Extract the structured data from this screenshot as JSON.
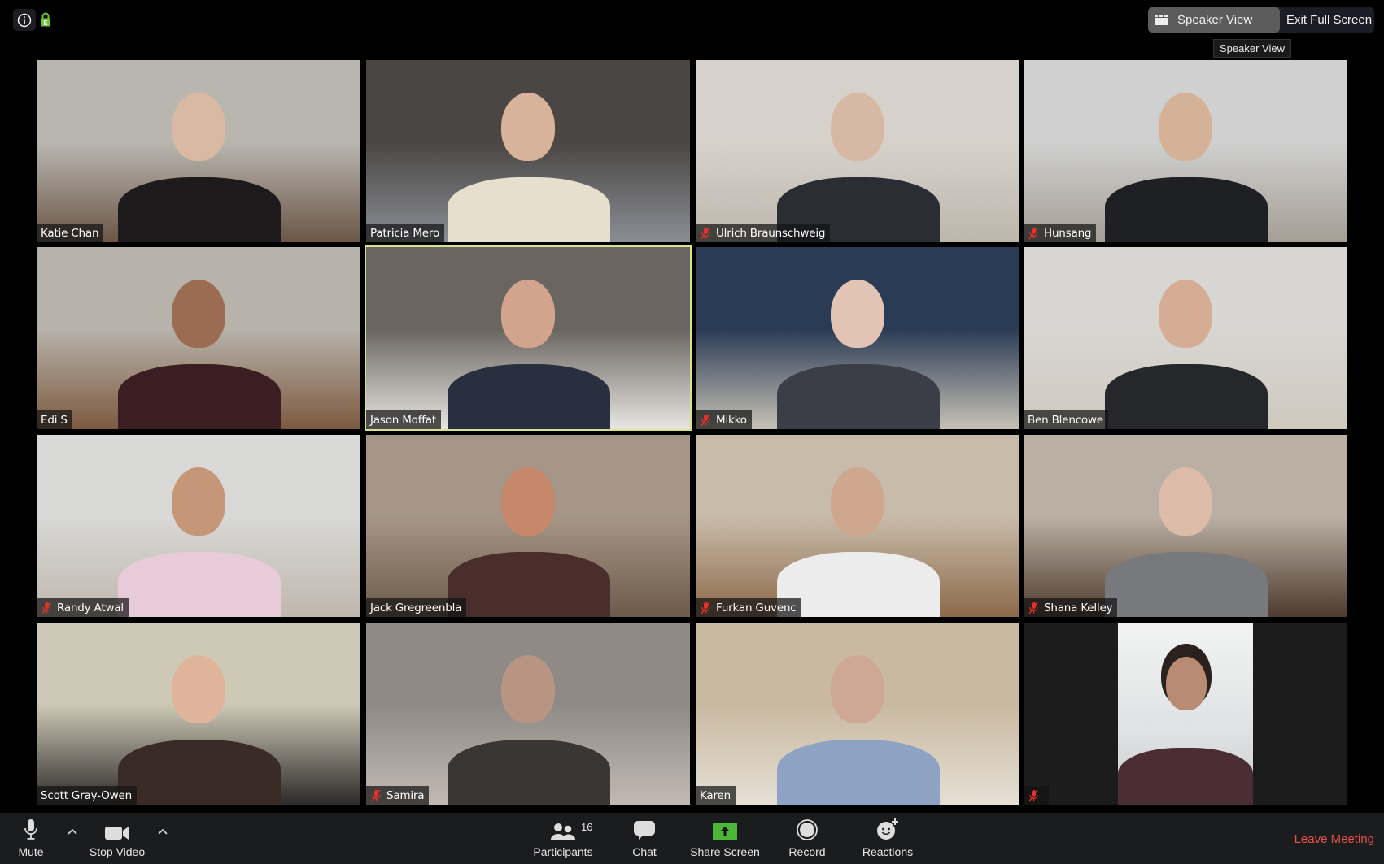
{
  "topbar": {
    "info_icon": "info-icon",
    "encryption_icon": "lock-icon",
    "encryption_badge_letter": "E",
    "speaker_view_label": "Speaker View",
    "exit_full_screen_label": "Exit Full Screen",
    "tooltip": "Speaker View"
  },
  "participants": [
    {
      "name": "Katie Chan",
      "muted": false,
      "active": false
    },
    {
      "name": "Patricia Mero",
      "muted": false,
      "active": false
    },
    {
      "name": "Ulrich Braunschweig",
      "muted": true,
      "active": false
    },
    {
      "name": "Hunsang",
      "muted": true,
      "active": false
    },
    {
      "name": "Edi S",
      "muted": false,
      "active": false
    },
    {
      "name": "Jason Moffat",
      "muted": false,
      "active": true
    },
    {
      "name": "Mikko",
      "muted": true,
      "active": false
    },
    {
      "name": "Ben Blencowe",
      "muted": false,
      "active": false
    },
    {
      "name": "Randy Atwal",
      "muted": true,
      "active": false
    },
    {
      "name": "Jack Gregreenbla",
      "muted": false,
      "active": false
    },
    {
      "name": "Furkan Guvenc",
      "muted": true,
      "active": false
    },
    {
      "name": "Shana Kelley",
      "muted": true,
      "active": false
    },
    {
      "name": "Scott Gray-Owen",
      "muted": false,
      "active": false
    },
    {
      "name": "Samira",
      "muted": true,
      "active": false
    },
    {
      "name": "Karen",
      "muted": false,
      "active": false
    },
    {
      "name": "",
      "muted": true,
      "active": false
    }
  ],
  "toolbar": {
    "mute_label": "Mute",
    "stop_video_label": "Stop Video",
    "participants_label": "Participants",
    "participants_count": "16",
    "chat_label": "Chat",
    "share_screen_label": "Share Screen",
    "record_label": "Record",
    "reactions_label": "Reactions",
    "leave_label": "Leave Meeting"
  },
  "colors": {
    "share_green": "#4cb636",
    "leave_red": "#e8504b",
    "active_speaker_border": "#d7e28a",
    "mute_red": "#e8312b"
  }
}
